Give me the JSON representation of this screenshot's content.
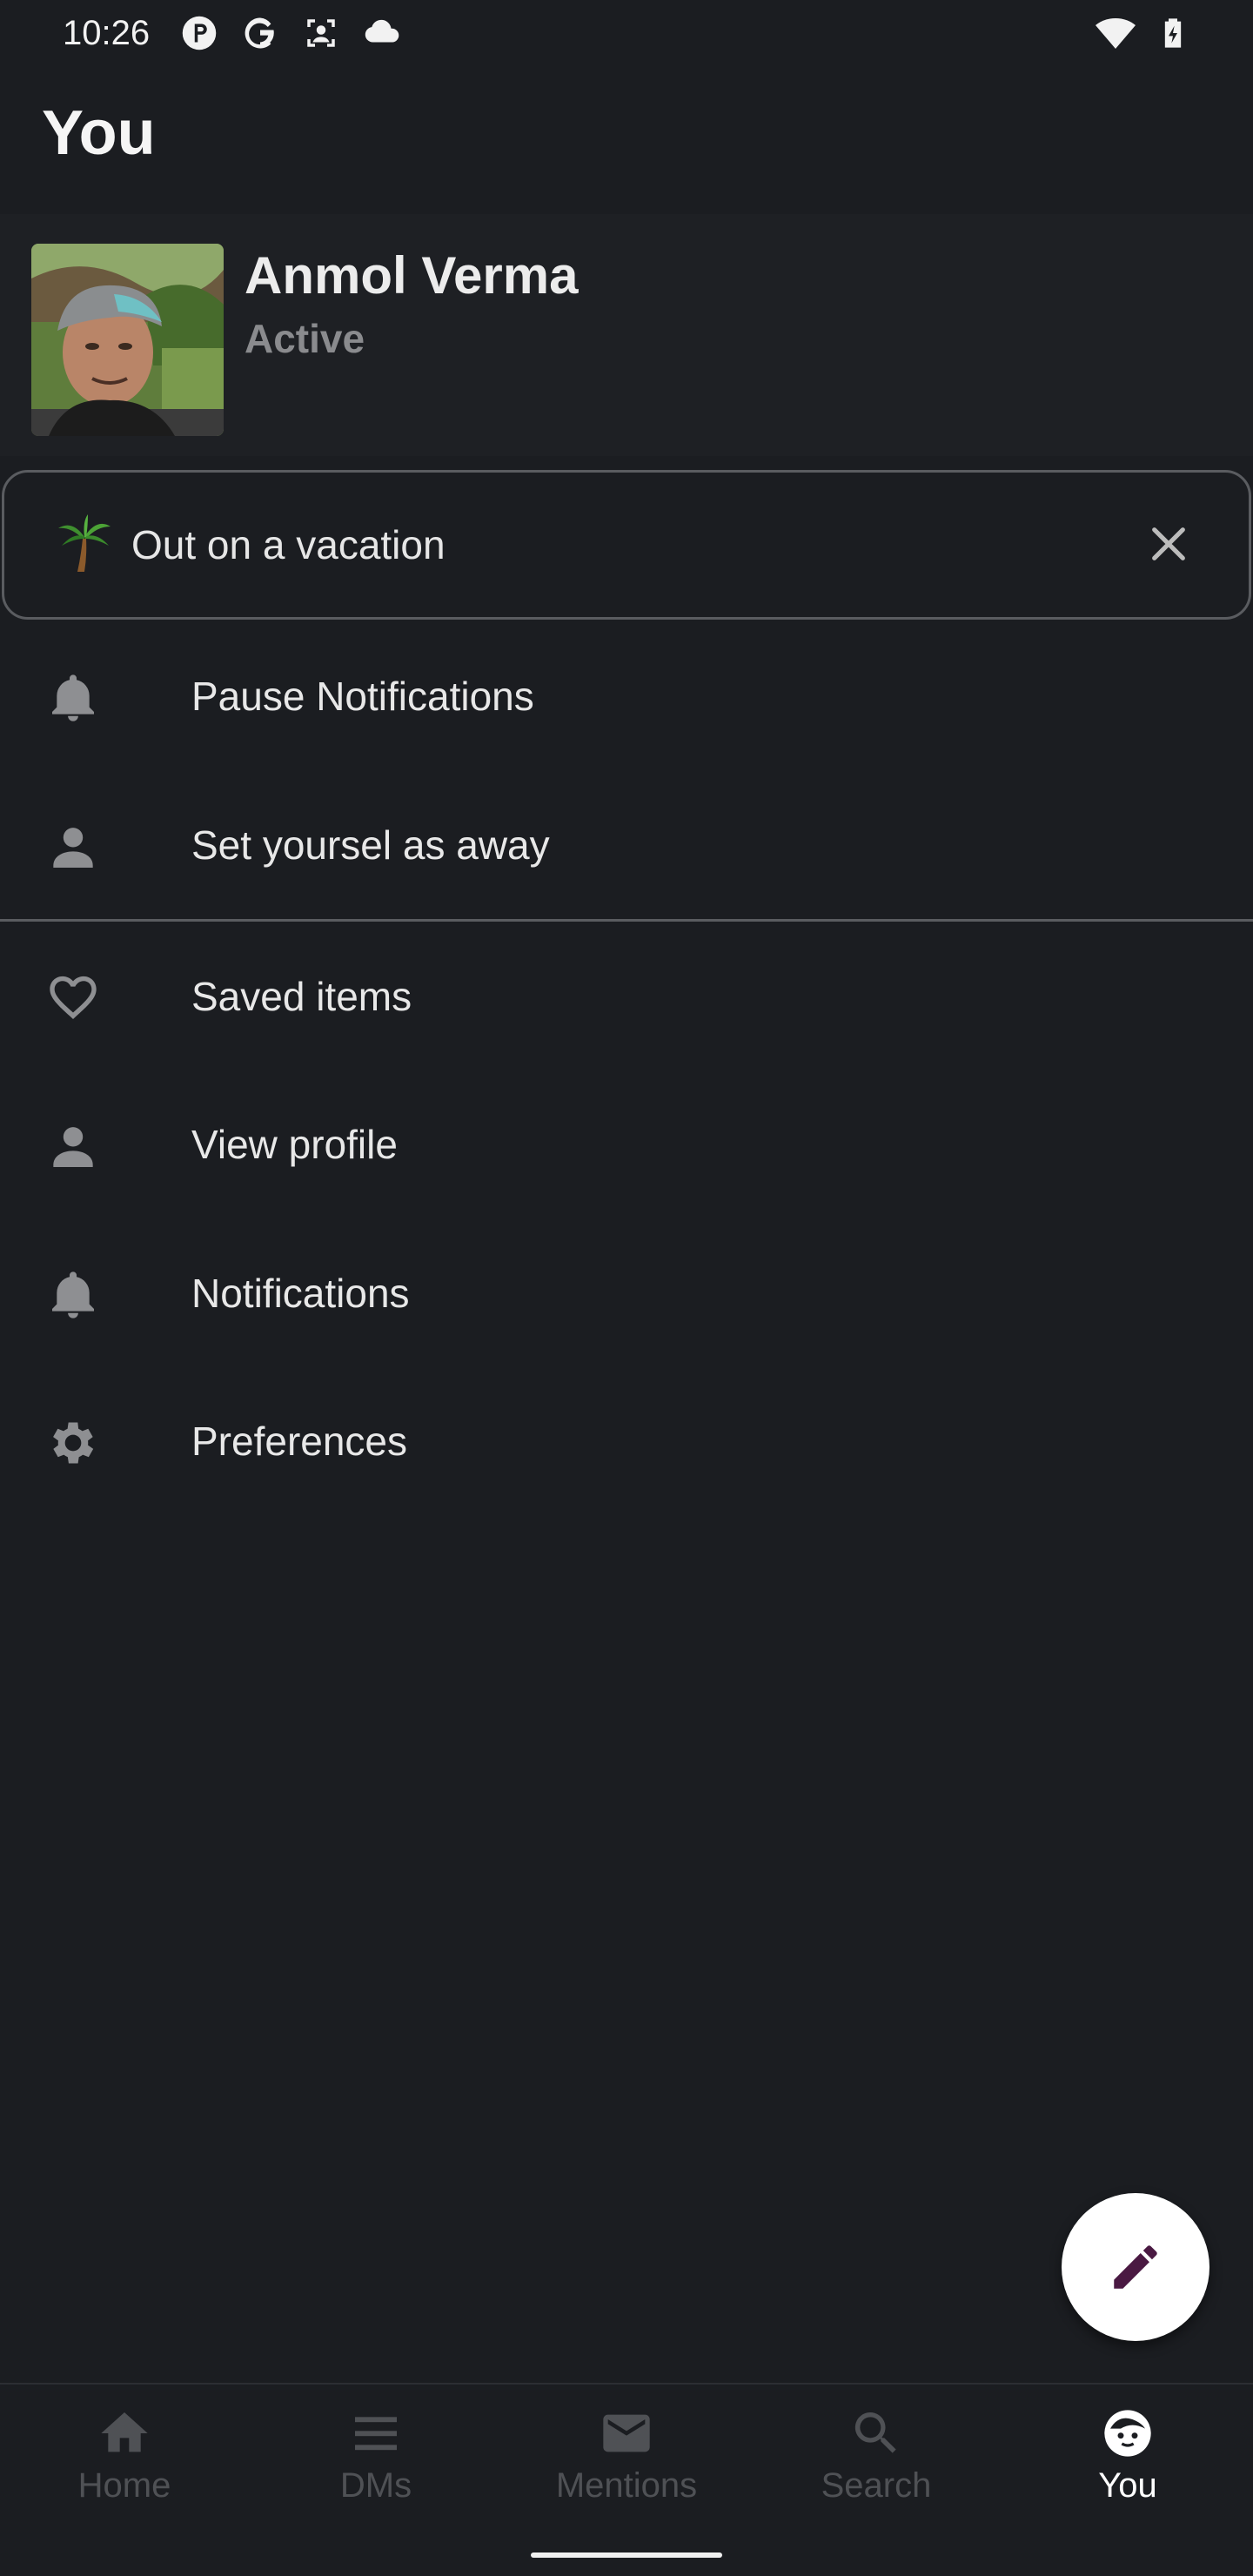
{
  "status_bar": {
    "time": "10:26",
    "icons": [
      "pinterest-icon",
      "google-icon",
      "face-scan-icon",
      "cloud-icon"
    ],
    "right_icons": [
      "wifi-icon",
      "battery-charging-icon"
    ]
  },
  "header": {
    "title": "You"
  },
  "profile": {
    "name": "Anmol Verma",
    "presence": "Active"
  },
  "custom_status": {
    "emoji": "palm-tree-icon",
    "text": "Out on a vacation"
  },
  "menu_top": [
    {
      "label": "Pause Notifications",
      "icon": "bell-icon"
    },
    {
      "label": "Set yoursel as away",
      "icon": "person-icon"
    }
  ],
  "menu_bottom": [
    {
      "label": "Saved items",
      "icon": "heart-outline-icon"
    },
    {
      "label": "View profile",
      "icon": "person-icon"
    },
    {
      "label": "Notifications",
      "icon": "bell-icon"
    },
    {
      "label": "Preferences",
      "icon": "gear-icon"
    }
  ],
  "fab": {
    "icon": "pencil-icon"
  },
  "bottom_nav": [
    {
      "label": "Home",
      "icon": "home-icon",
      "active": false
    },
    {
      "label": "DMs",
      "icon": "menu-lines-icon",
      "active": false
    },
    {
      "label": "Mentions",
      "icon": "mail-icon",
      "active": false
    },
    {
      "label": "Search",
      "icon": "search-icon",
      "active": false
    },
    {
      "label": "You",
      "icon": "face-icon",
      "active": true
    }
  ],
  "colors": {
    "background": "#1b1d21",
    "fab_icon": "#4a1942",
    "inactive_nav": "#4f5155",
    "active_nav": "#ffffff"
  }
}
